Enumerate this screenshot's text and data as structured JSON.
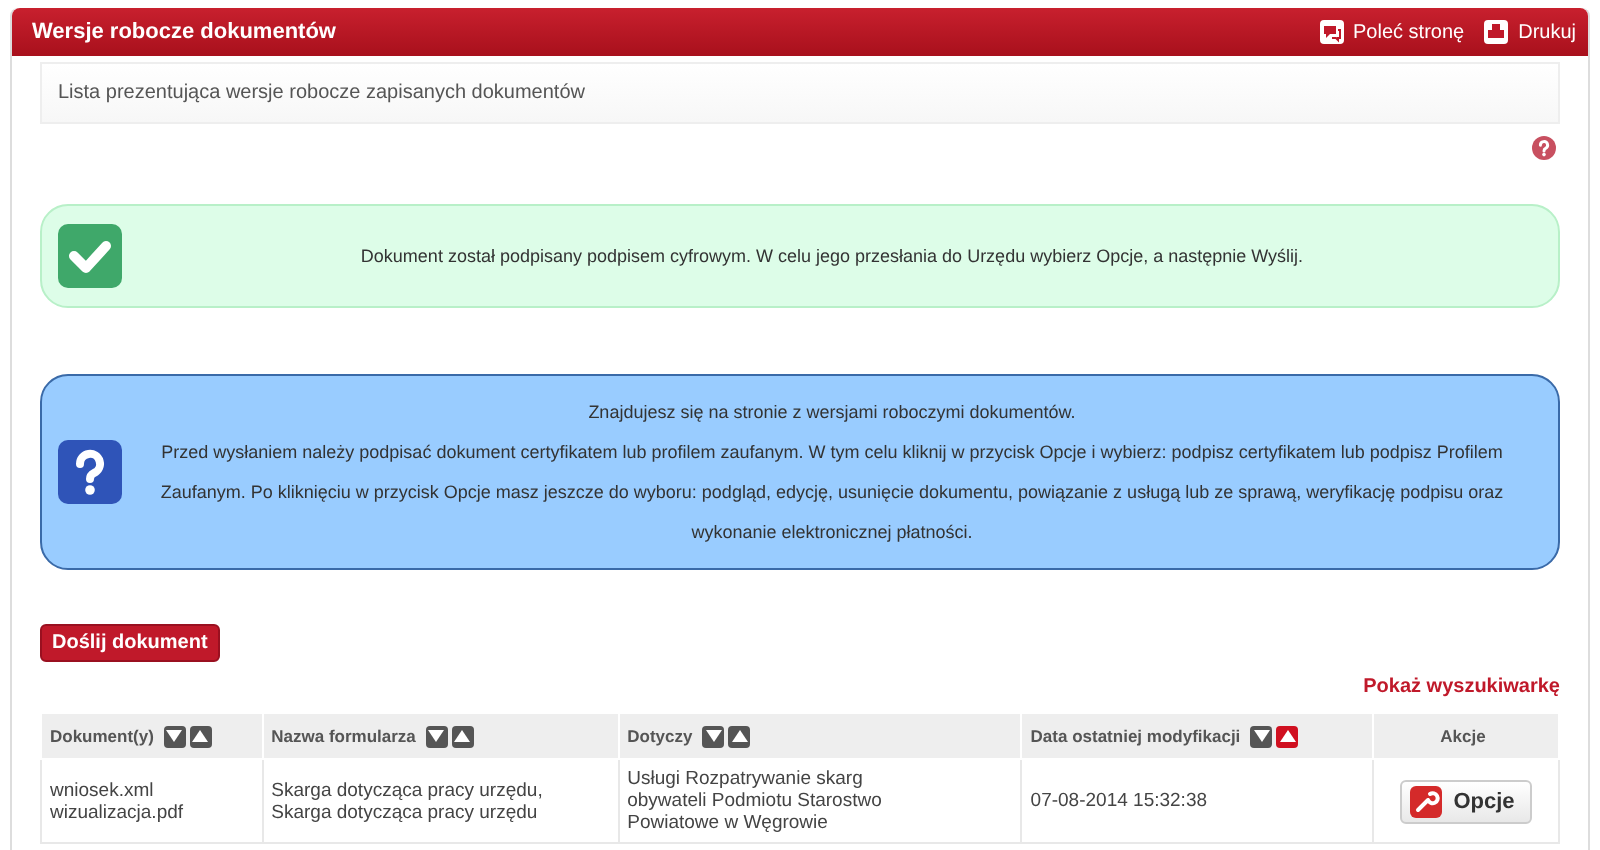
{
  "header": {
    "title": "Wersje robocze dokumentów",
    "actions": [
      "Poleć stronę",
      "Drukuj"
    ]
  },
  "description": "Lista prezentująca wersje robocze zapisanych dokumentów",
  "success_message": "Dokument został podpisany podpisem cyfrowym. W celu jego przesłania do Urzędu wybierz Opcje, a następnie Wyślij.",
  "info_message": [
    "Znajdujesz się na stronie z wersjami roboczymi dokumentów.",
    "Przed wysłaniem należy podpisać dokument certyfikatem lub profilem zaufanym. W tym celu kliknij w przycisk Opcje i wybierz: podpisz certyfikatem lub podpisz Profilem Zaufanym. Po kliknięciu w przycisk Opcje masz jeszcze do wyboru: podgląd, edycję, usunięcie dokumentu, powiązanie z usługą lub ze sprawą, weryfikację podpisu oraz wykonanie elektronicznej płatności."
  ],
  "add_button": "Doślij dokument",
  "search_link": "Pokaż wyszukiwarkę",
  "table": {
    "columns": [
      {
        "label": "Dokument(y)",
        "sortable": true,
        "sorted_ascending": false
      },
      {
        "label": "Nazwa formularza",
        "sortable": true,
        "sorted_ascending": false
      },
      {
        "label": "Dotyczy",
        "sortable": true,
        "sorted_ascending": false
      },
      {
        "label": "Data ostatniej modyfikacji",
        "sortable": true,
        "sorted_ascending": true
      },
      {
        "label": "Akcje",
        "sortable": false
      }
    ],
    "rows": [
      {
        "documents": [
          "wniosek.xml",
          "wizualizacja.pdf"
        ],
        "forms": [
          "Skarga dotycząca pracy urzędu,",
          "Skarga dotycząca pracy urzędu"
        ],
        "subject": "Usługi Rozpatrywanie skarg obywateli Podmiotu Starostwo Powiatowe w Węgrowie",
        "modified": "07-08-2014 15:32:38",
        "action": "Opcje"
      }
    ]
  }
}
